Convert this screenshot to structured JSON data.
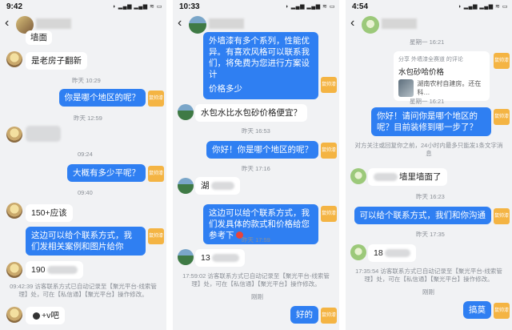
{
  "panels": [
    {
      "time": "9:42",
      "timestamps": [
        "昨天 10:29",
        "昨天 12:59",
        "09:24",
        "09:40"
      ],
      "messages": {
        "m1": "墙面",
        "m2": "是老房子翻新",
        "m3": "你是哪个地区的呢？",
        "m4": "大概有多少平呢？",
        "m5": "150+应该",
        "m6": "这边可以给个联系方式，我们发相关案例和图片给你",
        "m7": "190",
        "m8": "+v吧"
      },
      "system": "09:42:39 访客联系方式已自动记录至【聚光平台-线索管理】处，可在【私信通】【聚光平台】操作修改。"
    },
    {
      "time": "10:33",
      "timestamps": [
        "昨天 16:53",
        "昨天 17:16",
        "昨天 17:59",
        "刚刚"
      ],
      "messages": {
        "m1": "外墙漆有多个系列，性能优异。有喜欢风格可以联系我们，将免费为您进行方案设计",
        "m1b": "价格多少",
        "m2": "水包水比水包砂价格便宜？",
        "m3": "你好！你是哪个地区的呢？",
        "m4": "湖",
        "m5": "这边可以给个联系方式，我们发具体的款式和价格给您参考下",
        "m6": "13",
        "m7": "好的"
      },
      "system": "17:59:02 访客联系方式已自动记录至【聚光平台-线索管理】处，可在【私信通】【聚光平台】操作修改。"
    },
    {
      "time": "4:54",
      "timestamps": [
        "星期一 16:21",
        "星期一 16:21",
        "昨天 16:23",
        "昨天 17:35",
        "刚刚"
      ],
      "card": {
        "line1": "分享 外墙漆全赛道 的评论",
        "line2": "水包砂哈价格",
        "line3": "湖南农村自建房。还在科…"
      },
      "messages": {
        "m1": "你好！请问你是哪个地区的呢？目前装修到哪一步了？",
        "m2": "墙里墙面了",
        "m3": "可以给个联系方式，我们和你沟通",
        "m4": "18",
        "m5": "搞莫"
      },
      "system_reply": "对方关注或回复你之前，24小时内最多只能发1条文字消息",
      "system": "17:35:54 访客联系方式已自动记录至【聚光平台-线索管理】处，可在【私信通】【聚光平台】操作修改。"
    }
  ],
  "me_avatar_text": "鼠帅漆",
  "status_icons": "◗ ▂▄▆ ▂▄▆ ≋ ▭"
}
